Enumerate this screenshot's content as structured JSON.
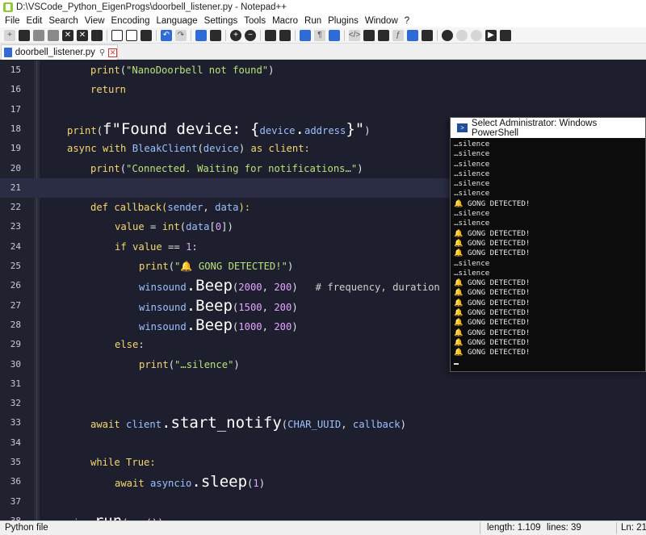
{
  "window": {
    "title": "D:\\VSCode_Python_EigenProgs\\doorbell_listener.py - Notepad++"
  },
  "menu": [
    "File",
    "Edit",
    "Search",
    "View",
    "Encoding",
    "Language",
    "Settings",
    "Tools",
    "Macro",
    "Run",
    "Plugins",
    "Window",
    "?"
  ],
  "toolbar_icons": [
    "new-file",
    "open-file",
    "save",
    "save-all",
    "close",
    "close-all",
    "print",
    "cut",
    "copy",
    "paste",
    "undo",
    "redo",
    "find",
    "replace",
    "zoom-in",
    "zoom-out",
    "sync-scroll-v",
    "sync-scroll-h",
    "word-wrap",
    "show-all-chars",
    "indent-guide",
    "udl",
    "doc-map",
    "function-list",
    "folder-as-workspace",
    "monitoring",
    "macro-record",
    "macro-stop",
    "macro-play",
    "macro-run-multiple",
    "macro-save"
  ],
  "tab": {
    "label": "doorbell_listener.py"
  },
  "editor": {
    "current_line": 21,
    "lines": [
      {
        "num": "15"
      },
      {
        "num": "16"
      },
      {
        "num": "17"
      },
      {
        "num": "18"
      },
      {
        "num": "19"
      },
      {
        "num": "20"
      },
      {
        "num": "21"
      },
      {
        "num": "22"
      },
      {
        "num": "23"
      },
      {
        "num": "24"
      },
      {
        "num": "25"
      },
      {
        "num": "26"
      },
      {
        "num": "27"
      },
      {
        "num": "28"
      },
      {
        "num": "29"
      },
      {
        "num": "30"
      },
      {
        "num": "31"
      },
      {
        "num": "32"
      },
      {
        "num": "33"
      },
      {
        "num": "34"
      },
      {
        "num": "35"
      },
      {
        "num": "36"
      },
      {
        "num": "37"
      },
      {
        "num": "38"
      }
    ],
    "tokens": {
      "l15": [
        "print",
        "(",
        "\"NanoDoorbell not found\"",
        ")"
      ],
      "l16": [
        "return"
      ],
      "l18": [
        "print",
        "(",
        "f\"Found device: {",
        "device",
        ".",
        "address",
        "}\"",
        ")"
      ],
      "l19": [
        "async",
        " with ",
        "BleakClient",
        "(",
        "device",
        ") ",
        "as",
        " client:"
      ],
      "l20": [
        "print",
        "(",
        "\"Connected. Waiting for notifications…\"",
        ")"
      ],
      "l22": [
        "def",
        " callback(",
        "sender",
        ", ",
        "data",
        "):"
      ],
      "l23": [
        "value",
        " = ",
        "int",
        "(",
        "data",
        "[",
        "0",
        "])"
      ],
      "l24": [
        "if",
        " ",
        "value",
        " == ",
        "1",
        ":"
      ],
      "l25": [
        "print",
        "(",
        "\"🔔 GONG DETECTED!\"",
        ")"
      ],
      "l26": [
        "winsound",
        ".",
        "Beep",
        "(",
        "2000",
        ", ",
        "200",
        ")",
        "   # frequency, duration"
      ],
      "l27": [
        "winsound",
        ".",
        "Beep",
        "(",
        "1500",
        ", ",
        "200",
        ")"
      ],
      "l28": [
        "winsound",
        ".",
        "Beep",
        "(",
        "1000",
        ", ",
        "200",
        ")"
      ],
      "l29": [
        "else",
        ":"
      ],
      "l30": [
        "print",
        "(",
        "\"…silence\"",
        ")"
      ],
      "l33": [
        "await",
        " client",
        ".",
        "start_notify",
        "(",
        "CHAR_UUID",
        ", ",
        "callback",
        ")"
      ],
      "l35": [
        "while",
        " True:"
      ],
      "l36": [
        "await",
        " asyncio",
        ".",
        "sleep",
        "(",
        "1",
        ")"
      ],
      "l38": [
        "asyncio",
        ".",
        "run",
        "(",
        "run",
        "())"
      ]
    }
  },
  "powershell": {
    "title": "Select Administrator: Windows PowerShell",
    "lines": [
      "…silence",
      "…silence",
      "…silence",
      "…silence",
      "…silence",
      "…silence",
      "🔔 GONG DETECTED!",
      "…silence",
      "…silence",
      "🔔 GONG DETECTED!",
      "🔔 GONG DETECTED!",
      "🔔 GONG DETECTED!",
      "…silence",
      "…silence",
      "🔔 GONG DETECTED!",
      "🔔 GONG DETECTED!",
      "🔔 GONG DETECTED!",
      "🔔 GONG DETECTED!",
      "🔔 GONG DETECTED!",
      "🔔 GONG DETECTED!",
      "🔔 GONG DETECTED!",
      "🔔 GONG DETECTED!"
    ]
  },
  "statusbar": {
    "file_type": "Python file",
    "length": "length: 1.109",
    "lines": "lines: 39",
    "position": "Ln: 21"
  }
}
